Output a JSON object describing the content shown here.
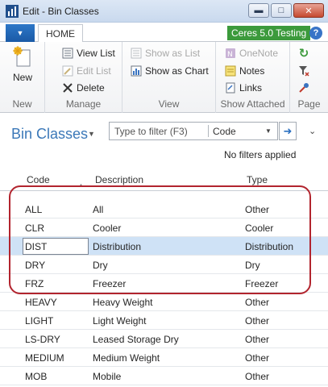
{
  "window": {
    "title": "Edit - Bin Classes"
  },
  "ribbon": {
    "tab_home": "HOME",
    "company": "Ceres 5.0 Testing",
    "groups": {
      "new": {
        "label": "New",
        "new_btn": "New"
      },
      "manage": {
        "label": "Manage",
        "view_list": "View List",
        "edit_list": "Edit List",
        "delete": "Delete"
      },
      "view": {
        "label": "View",
        "show_as_list": "Show as List",
        "show_as_chart": "Show as Chart"
      },
      "show_attached": {
        "label": "Show Attached",
        "onenote": "OneNote",
        "notes": "Notes",
        "links": "Links"
      },
      "page": {
        "label": "Page"
      }
    }
  },
  "page": {
    "title": "Bin Classes",
    "filter_placeholder": "Type to filter (F3)",
    "filter_field": "Code",
    "no_filters": "No filters applied"
  },
  "grid": {
    "columns": {
      "code": "Code",
      "description": "Description",
      "type": "Type"
    },
    "rows": [
      {
        "code": "ALL",
        "description": "All",
        "type": "Other"
      },
      {
        "code": "CLR",
        "description": "Cooler",
        "type": "Cooler"
      },
      {
        "code": "DIST",
        "description": "Distribution",
        "type": "Distribution"
      },
      {
        "code": "DRY",
        "description": "Dry",
        "type": "Dry"
      },
      {
        "code": "FRZ",
        "description": "Freezer",
        "type": "Freezer"
      },
      {
        "code": "HEAVY",
        "description": "Heavy Weight",
        "type": "Other"
      },
      {
        "code": "LIGHT",
        "description": "Light Weight",
        "type": "Other"
      },
      {
        "code": "LS-DRY",
        "description": "Leased Storage Dry",
        "type": "Other"
      },
      {
        "code": "MEDIUM",
        "description": "Medium Weight",
        "type": "Other"
      },
      {
        "code": "MOB",
        "description": "Mobile",
        "type": "Other"
      }
    ]
  },
  "colors": {
    "accent": "#3b78b8",
    "selected_row": "#cfe2f6",
    "annotation": "#b2242e",
    "company_badge": "#3c9a3c"
  },
  "icons": [
    "app-icon",
    "minimize-icon",
    "maximize-icon",
    "close-icon",
    "help-icon",
    "new-icon",
    "view-list-icon",
    "edit-list-icon",
    "delete-icon",
    "show-as-list-icon",
    "show-as-chart-icon",
    "onenote-icon",
    "notes-icon",
    "links-icon",
    "refresh-icon",
    "clear-filter-icon",
    "go-arrow-icon"
  ]
}
